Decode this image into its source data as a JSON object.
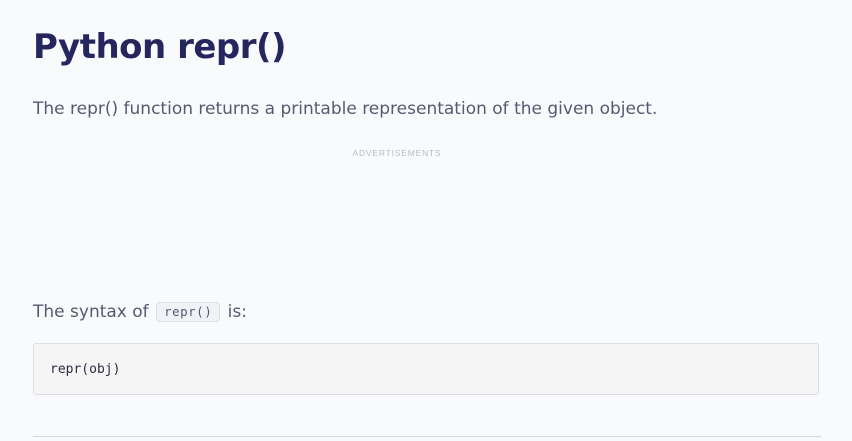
{
  "article": {
    "title": "Python repr()",
    "intro": "The repr() function returns a printable representation of the given object."
  },
  "ads": {
    "label": "ADVERTISEMENTS"
  },
  "syntax": {
    "prefix": "The syntax of",
    "inline_code": "repr()",
    "suffix": "is:",
    "code_block": "repr(obj)"
  }
}
